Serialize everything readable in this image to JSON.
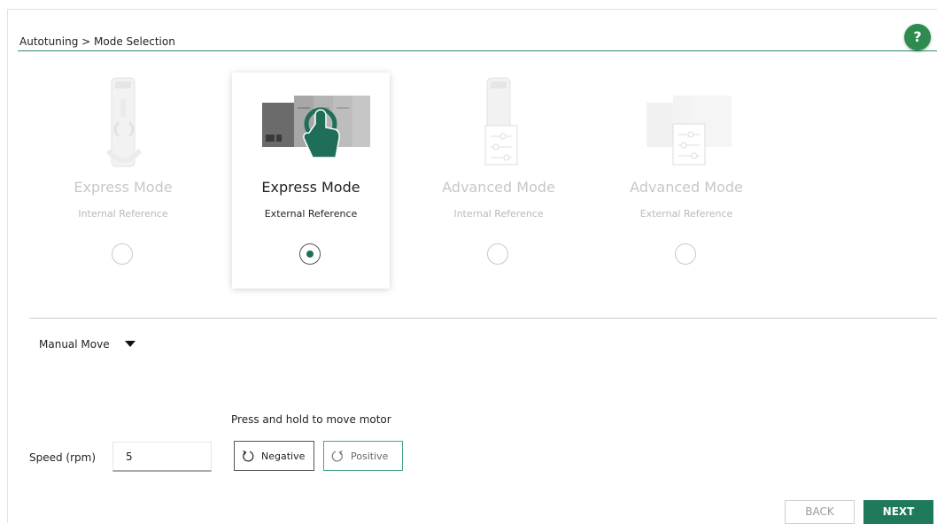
{
  "breadcrumb": "Autotuning > Mode Selection",
  "help": {
    "label": "?"
  },
  "modes": [
    {
      "title": "Express Mode",
      "subtitle": "Internal Reference",
      "selected": false
    },
    {
      "title": "Express Mode",
      "subtitle": "External Reference",
      "selected": true
    },
    {
      "title": "Advanced Mode",
      "subtitle": "Internal Reference",
      "selected": false
    },
    {
      "title": "Advanced Mode",
      "subtitle": "External Reference",
      "selected": false
    }
  ],
  "manual_move": {
    "label": "Manual Move"
  },
  "motor": {
    "hint": "Press and hold to move motor",
    "speed_label": "Speed (rpm)",
    "speed_value": "5",
    "negative_label": "Negative",
    "positive_label": "Positive"
  },
  "nav": {
    "back_label": "BACK",
    "next_label": "NEXT"
  },
  "colors": {
    "accent": "#1e7a5a",
    "help": "#2e8b4f",
    "divider": "#2e8b6e"
  }
}
